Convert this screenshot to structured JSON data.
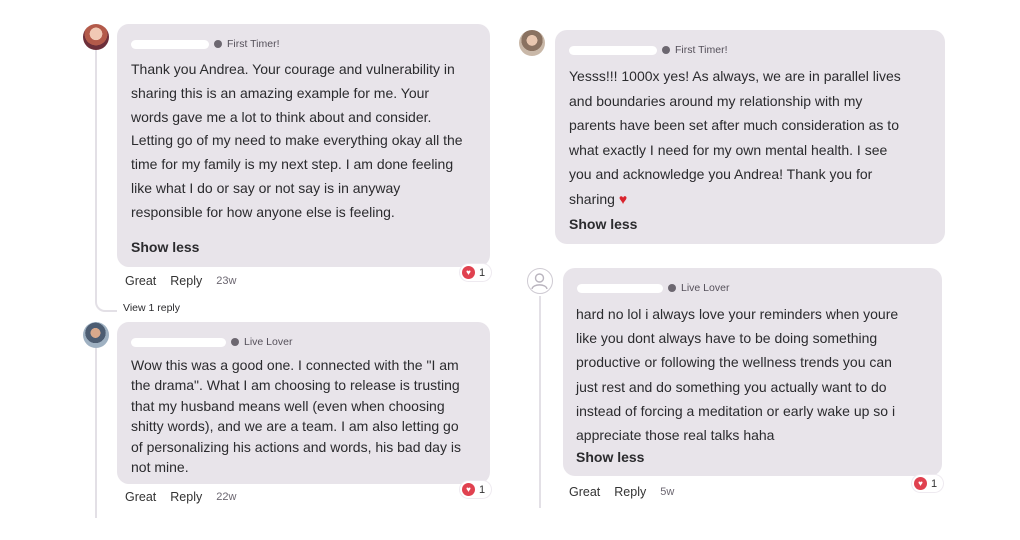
{
  "comments": [
    {
      "badge": "First Timer!",
      "lines": [
        "Thank you Andrea. Your courage and vulnerability in",
        "sharing this is an amazing example for me. Your",
        "words gave me a lot to think about and consider.",
        "Letting go of my need to make everything okay all the",
        "time for my family is my next step. I am done feeling",
        "like what I do or say or not say is in anyway",
        "responsible for how anyone else is feeling."
      ],
      "show_less": "Show less",
      "actions": {
        "great": "Great",
        "reply": "Reply",
        "time": "23w"
      },
      "reaction_count": "1",
      "view_replies": "View 1 reply"
    },
    {
      "badge": "Live Lover",
      "lines": [
        "Wow this was a good one. I connected with the \"I am",
        "the drama\". What I am choosing to release is trusting",
        "that my husband means well (even when choosing",
        "shitty words), and we are a team. I am also letting go",
        "of personalizing his actions and words, his bad day is",
        "not mine."
      ],
      "actions": {
        "great": "Great",
        "reply": "Reply",
        "time": "22w"
      },
      "reaction_count": "1"
    },
    {
      "badge": "First Timer!",
      "lines": [
        "Yesss!!! 1000x yes! As always, we are in parallel lives",
        "and boundaries around my relationship with my",
        "parents have been set after much consideration as to",
        "what exactly I need for my own mental health. I see",
        "you and acknowledge you Andrea! Thank you for",
        "sharing"
      ],
      "emoji": "♥",
      "show_less": "Show less"
    },
    {
      "badge": "Live Lover",
      "lines": [
        "hard no lol i always love your reminders when youre",
        "like you dont always have to be doing something",
        "productive or following the wellness trends you can",
        "just rest and do something you actually want to do",
        "instead of forcing a meditation or early wake up so i",
        "appreciate those real talks haha"
      ],
      "show_less": "Show less",
      "actions": {
        "great": "Great",
        "reply": "Reply",
        "time": "5w"
      },
      "reaction_count": "1"
    }
  ],
  "icons": {
    "reaction": "heart-icon",
    "badge": "badge-dot-icon",
    "avatar_placeholder": "user-icon"
  },
  "colors": {
    "bubble": "#e8e4ea",
    "heart": "#e0414f"
  }
}
